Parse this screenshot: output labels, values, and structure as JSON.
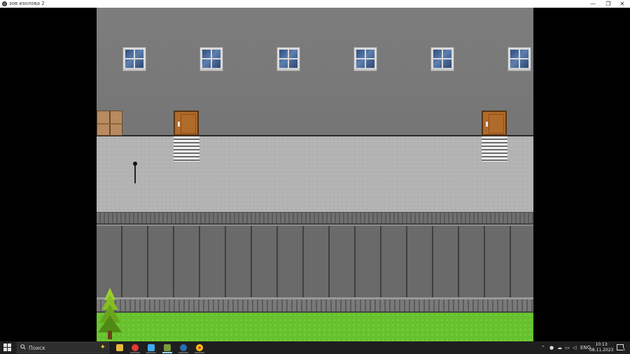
{
  "window": {
    "title": "зов изолова 2",
    "controls": {
      "minimize": "—",
      "maximize": "❐",
      "close": "✕"
    }
  },
  "game": {
    "scene": "street",
    "windows_count": 6,
    "doors_count": 2
  },
  "taskbar": {
    "search_placeholder": "Поиск",
    "apps": [
      "file-explorer",
      "yandex-browser",
      "store",
      "rpg-maker-game",
      "steam",
      "chrome"
    ],
    "tray": {
      "language": "ENG",
      "time": "10:13",
      "date": "08.11.2023",
      "notifications": "1"
    }
  }
}
